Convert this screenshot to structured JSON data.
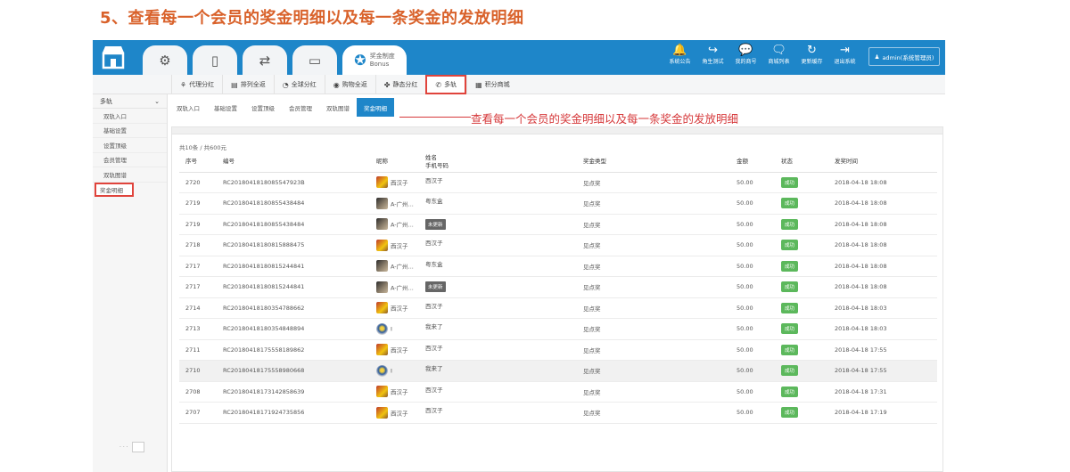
{
  "heading": "5、查看每一个会员的奖金明细以及每一条奖金的发放明细",
  "topbar": {
    "tabs": [
      {
        "icon": "gear-icon",
        "glyph": "⚙"
      },
      {
        "icon": "mobile-icon",
        "glyph": "▯"
      },
      {
        "icon": "transfer-icon",
        "glyph": "⇄"
      },
      {
        "icon": "monitor-icon",
        "glyph": "▭"
      }
    ],
    "active_tab": {
      "icon": "medal-icon",
      "glyph": "✪",
      "title": "奖金制度",
      "subtitle": "Bonus"
    },
    "actions": [
      {
        "icon": "bell-icon",
        "glyph": "🔔",
        "label": "系统公告"
      },
      {
        "icon": "share-icon",
        "glyph": "↪",
        "label": "角生测试"
      },
      {
        "icon": "wechat-icon",
        "glyph": "💬",
        "label": "我的商号"
      },
      {
        "icon": "chat-icon",
        "glyph": "🗨",
        "label": "商城列表"
      },
      {
        "icon": "refresh-icon",
        "glyph": "↻",
        "label": "更新缓存"
      },
      {
        "icon": "logout-icon",
        "glyph": "⇥",
        "label": "退出系统"
      }
    ],
    "admin": "admin(系统管理员)"
  },
  "subbar": {
    "items": [
      {
        "glyph": "⚘",
        "label": "代理分红"
      },
      {
        "glyph": "▤",
        "label": "排列全返"
      },
      {
        "glyph": "◔",
        "label": "全球分红"
      },
      {
        "glyph": "◉",
        "label": "购物全返"
      },
      {
        "glyph": "✤",
        "label": "静态分红"
      },
      {
        "glyph": "✆",
        "label": "多轨"
      },
      {
        "glyph": "▦",
        "label": "积分商城"
      }
    ]
  },
  "sidebar": {
    "header": "多轨",
    "items": [
      "双轨入口",
      "基础设置",
      "设置顶级",
      "会员管理",
      "双轨图谱",
      "奖金明细"
    ]
  },
  "content_tabs": [
    "双轨入口",
    "基础设置",
    "设置顶级",
    "会员管理",
    "双轨图谱",
    "奖金明细"
  ],
  "annotation": "查看每一个会员的奖金明细以及每一条奖金的发放明细",
  "table": {
    "total": "共10条 / 共600元",
    "headers": {
      "id": "序号",
      "code": "编号",
      "nick": "昵称",
      "name": "姓名",
      "phone": "手机号码",
      "type": "奖金类型",
      "amount": "金额",
      "status": "状态",
      "time": "发奖时间"
    },
    "rows": [
      {
        "id": "2720",
        "code": "RC2018041818085547923B",
        "nick": "西汉子",
        "avatar": "a",
        "name": "西汉子",
        "type": "见点奖",
        "amount": "50.00",
        "status": "成功",
        "time": "2018-04-18 18:08"
      },
      {
        "id": "2719",
        "code": "RC2018041818085543848​4",
        "nick": "A-广州...",
        "avatar": "b",
        "name": "粤东盒",
        "type": "见点奖",
        "amount": "50.00",
        "status": "成功",
        "time": "2018-04-18 18:08"
      },
      {
        "id": "2719",
        "code": "RC20180418180855438484",
        "nick": "A-广州...",
        "avatar": "b",
        "name": "未更新",
        "unset": true,
        "type": "见点奖",
        "amount": "50.00",
        "status": "成功",
        "time": "2018-04-18 18:08"
      },
      {
        "id": "2718",
        "code": "RC20180418180815888475",
        "nick": "西汉子",
        "avatar": "a",
        "name": "西汉子",
        "type": "见点奖",
        "amount": "50.00",
        "status": "成功",
        "time": "2018-04-18 18:08"
      },
      {
        "id": "2717",
        "code": "RC20180418180815244841",
        "nick": "A-广州...",
        "avatar": "b",
        "name": "粤东盒",
        "type": "见点奖",
        "amount": "50.00",
        "status": "成功",
        "time": "2018-04-18 18:08"
      },
      {
        "id": "2717",
        "code": "RC20180418180815244841",
        "nick": "A-广州...",
        "avatar": "b",
        "name": "未更新",
        "unset": true,
        "type": "见点奖",
        "amount": "50.00",
        "status": "成功",
        "time": "2018-04-18 18:08"
      },
      {
        "id": "2714",
        "code": "RC20180418180354788662",
        "nick": "西汉子",
        "avatar": "a",
        "name": "西汉子",
        "type": "见点奖",
        "amount": "50.00",
        "status": "成功",
        "time": "2018-04-18 18:03"
      },
      {
        "id": "2713",
        "code": "RC20180418180354848894",
        "nick": "I",
        "avatar": "c",
        "name": "我来了",
        "type": "见点奖",
        "amount": "50.00",
        "status": "成功",
        "time": "2018-04-18 18:03"
      },
      {
        "id": "2711",
        "code": "RC20180418175558189862",
        "nick": "西汉子",
        "avatar": "a",
        "name": "西汉子",
        "type": "见点奖",
        "amount": "50.00",
        "status": "成功",
        "time": "2018-04-18 17:55"
      },
      {
        "id": "2710",
        "code": "RC20180418175558980668",
        "nick": "I",
        "avatar": "c",
        "name": "我来了",
        "type": "见点奖",
        "amount": "50.00",
        "status": "成功",
        "time": "2018-04-18 17:55",
        "shade": true
      },
      {
        "id": "2708",
        "code": "RC20180418173142858639",
        "nick": "西汉子",
        "avatar": "a",
        "name": "西汉子",
        "type": "见点奖",
        "amount": "50.00",
        "status": "成功",
        "time": "2018-04-18 17:31"
      },
      {
        "id": "2707",
        "code": "RC20180418171924735856",
        "nick": "西汉子",
        "avatar": "a",
        "name": "西汉子",
        "type": "见点奖",
        "amount": "50.00",
        "status": "成功",
        "time": "2018-04-18 17:19"
      }
    ]
  }
}
